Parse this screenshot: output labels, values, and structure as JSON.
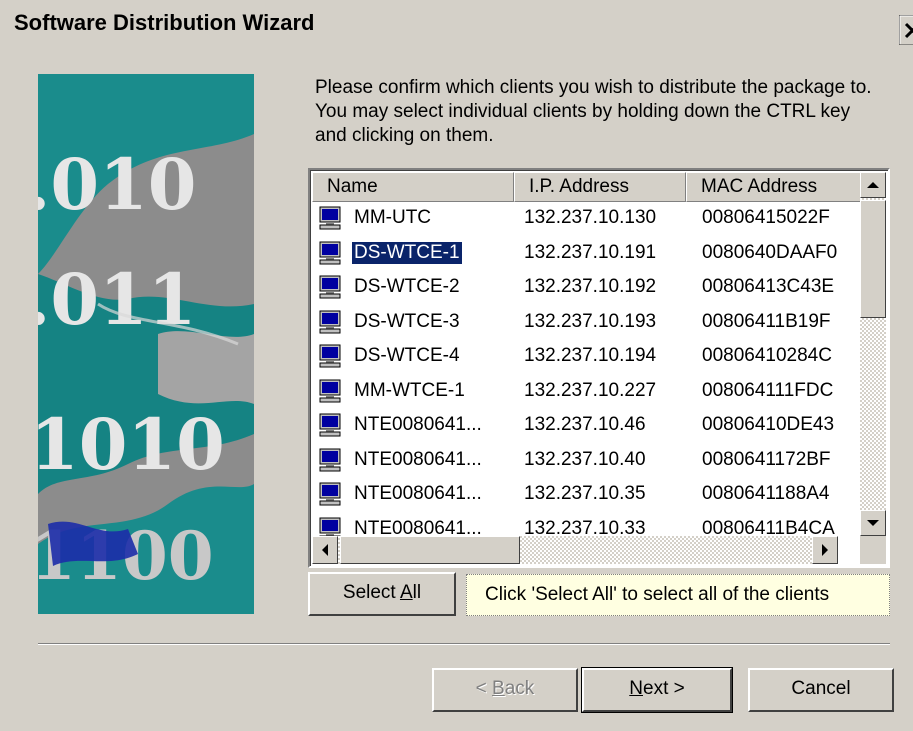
{
  "window": {
    "title": "Software Distribution Wizard"
  },
  "instructions": "Please confirm which clients you wish to distribute the package to.  You may select individual clients by holding down the CTRL key and clicking on them.",
  "list": {
    "columns": [
      "Name",
      "I.P. Address",
      "MAC Address"
    ],
    "rows": [
      {
        "name": " MM-UTC",
        "ip": "132.237.10.130",
        "mac": "00806415022F",
        "selected": false
      },
      {
        "name": "DS-WTCE-1",
        "ip": "132.237.10.191",
        "mac": "0080640DAAF0",
        "selected": true
      },
      {
        "name": "DS-WTCE-2",
        "ip": "132.237.10.192",
        "mac": "00806413C43E",
        "selected": false
      },
      {
        "name": "DS-WTCE-3",
        "ip": "132.237.10.193",
        "mac": "00806411B19F",
        "selected": false
      },
      {
        "name": "DS-WTCE-4",
        "ip": "132.237.10.194",
        "mac": "00806410284C",
        "selected": false
      },
      {
        "name": "MM-WTCE-1",
        "ip": "132.237.10.227",
        "mac": "008064111FDC",
        "selected": false
      },
      {
        "name": "NTE0080641...",
        "ip": "132.237.10.46",
        "mac": "00806410DE43",
        "selected": false
      },
      {
        "name": "NTE0080641...",
        "ip": "132.237.10.40",
        "mac": "0080641172BF",
        "selected": false
      },
      {
        "name": "NTE0080641...",
        "ip": "132.237.10.35",
        "mac": "0080641188A4",
        "selected": false
      },
      {
        "name": "NTE0080641...",
        "ip": "132.237.10.33",
        "mac": "00806411B4CA",
        "selected": false
      }
    ]
  },
  "buttons": {
    "select_all": {
      "pre": "Select ",
      "key": "A",
      "post": "ll"
    },
    "back": {
      "pre": "< ",
      "key": "B",
      "post": "ack"
    },
    "next": {
      "pre": "",
      "key": "N",
      "post": "ext >"
    },
    "cancel": "Cancel"
  },
  "hint": "Click 'Select All' to select all of the clients",
  "art": {
    "digits": [
      ".010",
      ".011",
      "1010",
      "1100"
    ]
  },
  "colors": {
    "selection": "#0a246a",
    "face": "#d4d0c8",
    "hint_bg": "#ffffe1",
    "art_teal": "#1a8c8c"
  },
  "icons": [
    "close-icon",
    "computer-icon",
    "scroll-up-icon",
    "scroll-down-icon",
    "scroll-left-icon",
    "scroll-right-icon"
  ]
}
